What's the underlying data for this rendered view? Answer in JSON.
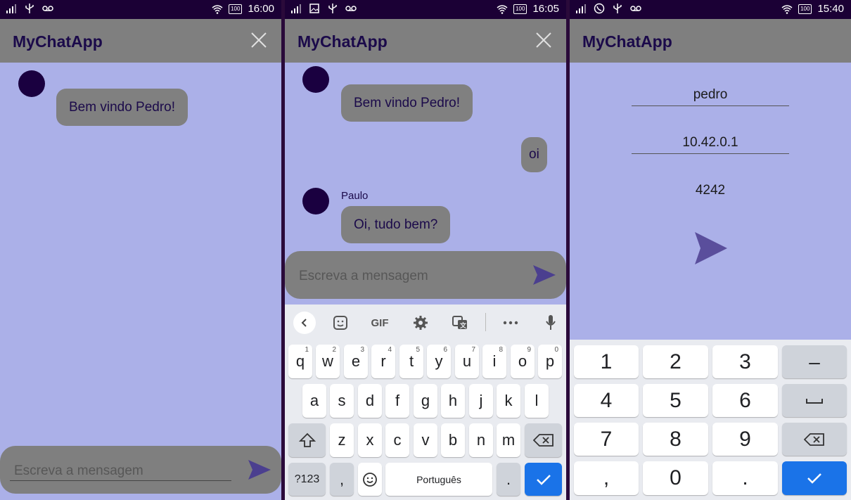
{
  "screens": [
    {
      "status": {
        "time": "16:00"
      },
      "appbar": {
        "title": "MyChatApp"
      },
      "messages": [
        {
          "text": "Bem vindo Pedro!"
        }
      ],
      "composer": {
        "placeholder": "Escreva a mensagem"
      }
    },
    {
      "status": {
        "time": "16:05"
      },
      "appbar": {
        "title": "MyChatApp"
      },
      "messages": [
        {
          "text": "Bem vindo Pedro!"
        },
        {
          "text": "oi"
        },
        {
          "sender": "Paulo",
          "text": "Oi, tudo bem?"
        }
      ],
      "composer": {
        "placeholder": "Escreva a mensagem"
      },
      "keyboard": {
        "toolbar": [
          "back-chevron-icon",
          "sticker-icon",
          "GIF",
          "settings-icon",
          "translate-icon",
          "more-icon",
          "mic-icon"
        ],
        "row1": [
          {
            "k": "q",
            "n": "1"
          },
          {
            "k": "w",
            "n": "2"
          },
          {
            "k": "e",
            "n": "3"
          },
          {
            "k": "r",
            "n": "4"
          },
          {
            "k": "t",
            "n": "5"
          },
          {
            "k": "y",
            "n": "6"
          },
          {
            "k": "u",
            "n": "7"
          },
          {
            "k": "i",
            "n": "8"
          },
          {
            "k": "o",
            "n": "9"
          },
          {
            "k": "p",
            "n": "0"
          }
        ],
        "row2": [
          "a",
          "s",
          "d",
          "f",
          "g",
          "h",
          "j",
          "k",
          "l"
        ],
        "row3": [
          "z",
          "x",
          "c",
          "v",
          "b",
          "n",
          "m"
        ],
        "symbols_label": "?123",
        "comma": ",",
        "space_label": "Português",
        "period": "."
      }
    },
    {
      "status": {
        "time": "15:40"
      },
      "appbar": {
        "title": "MyChatApp"
      },
      "form": {
        "name": "pedro",
        "ip": "10.42.0.1",
        "port": "4242"
      },
      "numpad": {
        "rows": [
          [
            "1",
            "2",
            "3",
            "–"
          ],
          [
            "4",
            "5",
            "6",
            "␣"
          ],
          [
            "7",
            "8",
            "9",
            "⌫"
          ],
          [
            ",",
            "0",
            ".",
            "✓"
          ]
        ]
      }
    }
  ],
  "colors": {
    "background": "#abb0e8",
    "statusbar": "#1b0035",
    "appbar": "#7f7f7f",
    "bubble": "#808080",
    "avatar": "#1a0040",
    "text_dark": "#1b0a4a",
    "send_icon": "#4b3f8f",
    "keyboard_bg": "#e9ebf0",
    "enter_key": "#1a73e8"
  }
}
